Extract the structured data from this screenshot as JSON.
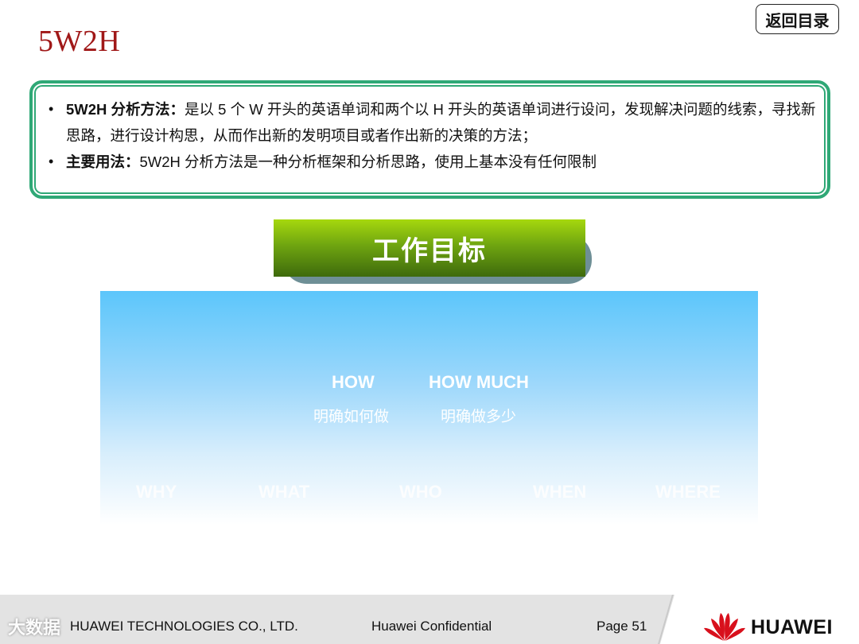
{
  "slide": {
    "title": "5W2H",
    "back_button": "返回目录"
  },
  "info": {
    "item1_bold": "5W2H 分析方法：",
    "item1_text": "是以 5 个 W 开头的英语单词和两个以 H 开头的英语单词进行设问，发现解决问题的线索，寻找新思路，进行设计构思，从而作出新的发明项目或者作出新的决策的方法；",
    "item2_bold": "主要用法：",
    "item2_text": "5W2H 分析方法是一种分析框架和分析思路，使用上基本没有任何限制",
    "bullet": "•"
  },
  "goal": {
    "label": "工作目标"
  },
  "diagram": {
    "how_en": "HOW",
    "how_cn": "明确如何做",
    "howmuch_en": "HOW MUCH",
    "howmuch_cn": "明确做多少",
    "why": "WHY",
    "what": "WHAT",
    "who": "WHO",
    "when": "WHEN",
    "where": "WHERE"
  },
  "footer": {
    "company": "HUAWEI TECHNOLOGIES CO., LTD.",
    "confidential": "Huawei Confidential",
    "page": "Page 51",
    "logo_text": "HUAWEI",
    "watermark": "大数据"
  },
  "colors": {
    "title": "#a01818",
    "box_border": "#2fa876",
    "goal_green": "#6fa510",
    "sky_blue": "#5cc6fb"
  }
}
